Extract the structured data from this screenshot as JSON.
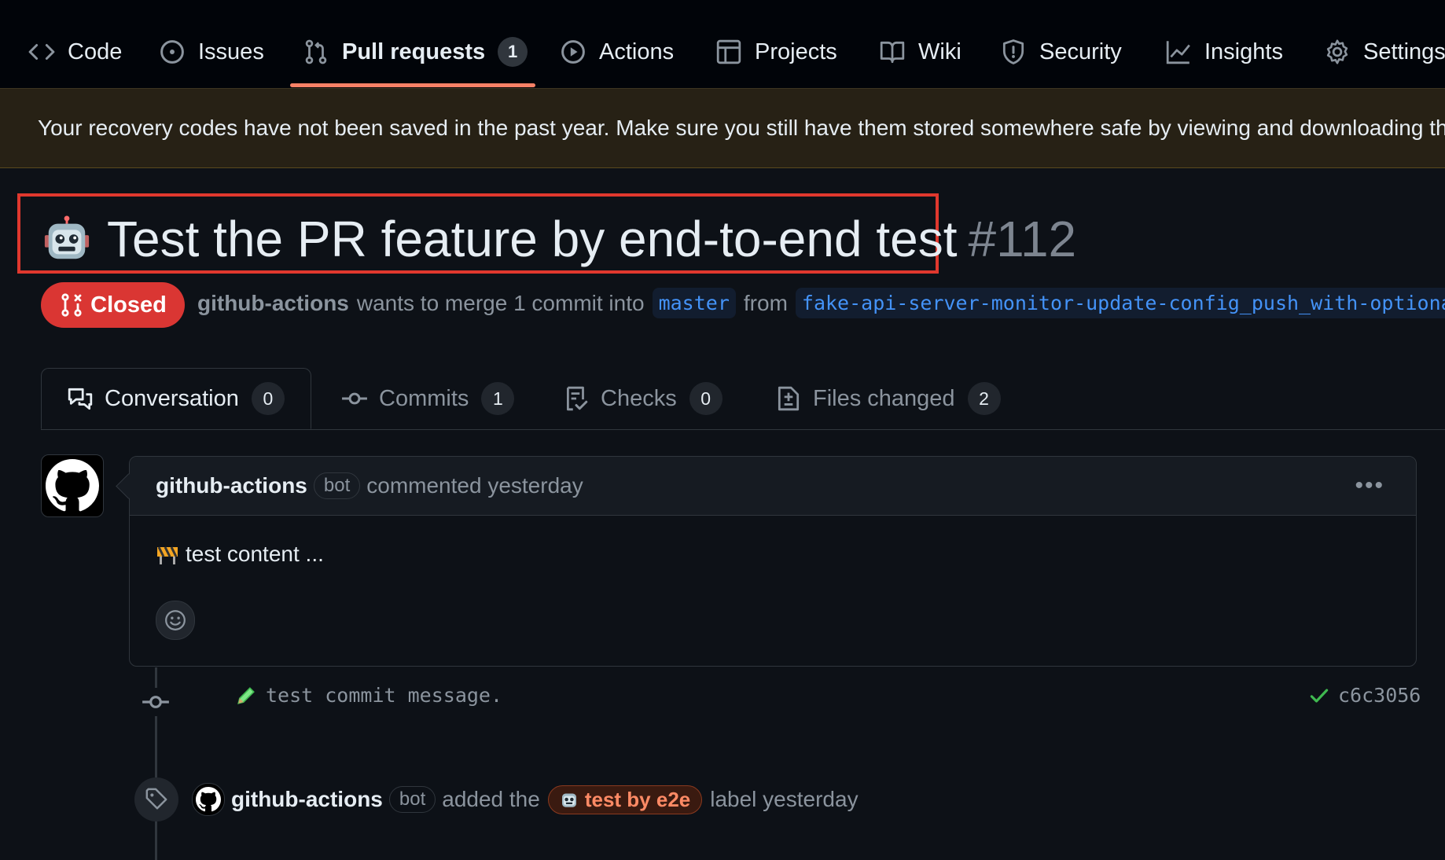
{
  "nav": {
    "items": [
      {
        "label": "Code",
        "icon": "code-icon"
      },
      {
        "label": "Issues",
        "icon": "issue-opened-icon"
      },
      {
        "label": "Pull requests",
        "icon": "git-pull-request-icon",
        "count": "1",
        "active": true
      },
      {
        "label": "Actions",
        "icon": "play-icon"
      },
      {
        "label": "Projects",
        "icon": "table-icon"
      },
      {
        "label": "Wiki",
        "icon": "book-icon"
      },
      {
        "label": "Security",
        "icon": "shield-icon"
      },
      {
        "label": "Insights",
        "icon": "graph-icon"
      },
      {
        "label": "Settings",
        "icon": "gear-icon"
      }
    ]
  },
  "banner": {
    "text": "Your recovery codes have not been saved in the past year. Make sure you still have them stored somewhere safe by viewing and downloading them."
  },
  "pr": {
    "title": "Test the PR feature by end-to-end test",
    "number": "#112",
    "status": "Closed",
    "author": "github-actions",
    "merge_text": "wants to merge 1 commit into",
    "base_branch": "master",
    "from_text": "from",
    "head_branch": "fake-api-server-monitor-update-config_push_with-optional-"
  },
  "tabs": [
    {
      "label": "Conversation",
      "count": "0",
      "icon": "comment-discussion-icon"
    },
    {
      "label": "Commits",
      "count": "1",
      "icon": "git-commit-icon"
    },
    {
      "label": "Checks",
      "count": "0",
      "icon": "checklist-icon"
    },
    {
      "label": "Files changed",
      "count": "2",
      "icon": "file-diff-icon"
    }
  ],
  "comment": {
    "author": "github-actions",
    "badge": "bot",
    "meta": "commented yesterday",
    "body": "test content ..."
  },
  "commit": {
    "message": "test commit message.",
    "sha": "c6c3056"
  },
  "label_event": {
    "author": "github-actions",
    "badge": "bot",
    "text_before": "added the",
    "label": "test by e2e",
    "text_after": "label yesterday"
  },
  "colors": {
    "accent_underline": "#f78166",
    "closed_red": "#da3633",
    "branch_blue": "#4493f8",
    "highlight_box": "#e0382e"
  }
}
